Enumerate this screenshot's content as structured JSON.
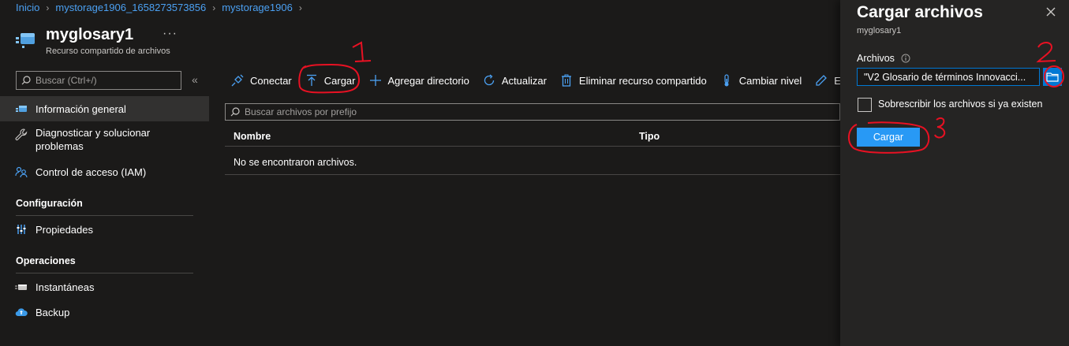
{
  "breadcrumb": [
    "Inicio",
    "mystorage1906_1658273573856",
    "mystorage1906"
  ],
  "header": {
    "title": "myglosary1",
    "subtitle": "Recurso compartido de archivos",
    "more": "···"
  },
  "sidebar": {
    "search_placeholder": "Buscar (Ctrl+/)",
    "collapse": "«",
    "items": [
      {
        "label": "Información general",
        "icon": "file-share-icon",
        "active": true
      },
      {
        "label": "Diagnosticar y solucionar problemas",
        "icon": "wrench-icon"
      },
      {
        "label": "Control de acceso (IAM)",
        "icon": "people-icon"
      }
    ],
    "sections": [
      {
        "title": "Configuración",
        "items": [
          {
            "label": "Propiedades",
            "icon": "properties-icon"
          }
        ]
      },
      {
        "title": "Operaciones",
        "items": [
          {
            "label": "Instantáneas",
            "icon": "snapshot-icon"
          },
          {
            "label": "Backup",
            "icon": "cloud-backup-icon"
          }
        ]
      }
    ]
  },
  "toolbar": {
    "connect": "Conectar",
    "upload": "Cargar",
    "add_directory": "Agregar directorio",
    "refresh": "Actualizar",
    "delete_share": "Eliminar recurso compartido",
    "change_tier": "Cambiar nivel",
    "edit": "Edi"
  },
  "main": {
    "search_placeholder": "Buscar archivos por prefijo",
    "columns": [
      "Nombre",
      "Tipo"
    ],
    "empty_message": "No se encontraron archivos."
  },
  "panel": {
    "title": "Cargar archivos",
    "subtitle": "myglosary1",
    "files_label": "Archivos",
    "files_value": "\"V2 Glosario de términos Innovacci...",
    "overwrite_label": "Sobrescribir los archivos si ya existen",
    "overwrite_checked": false,
    "upload_button": "Cargar"
  },
  "annotations": [
    "1",
    "2",
    "3"
  ],
  "colors": {
    "background": "#1b1a19",
    "panel": "#252423",
    "accent": "#0078d4",
    "link": "#4ba0f2",
    "button": "#2899f5",
    "annotation": "#e81123"
  }
}
